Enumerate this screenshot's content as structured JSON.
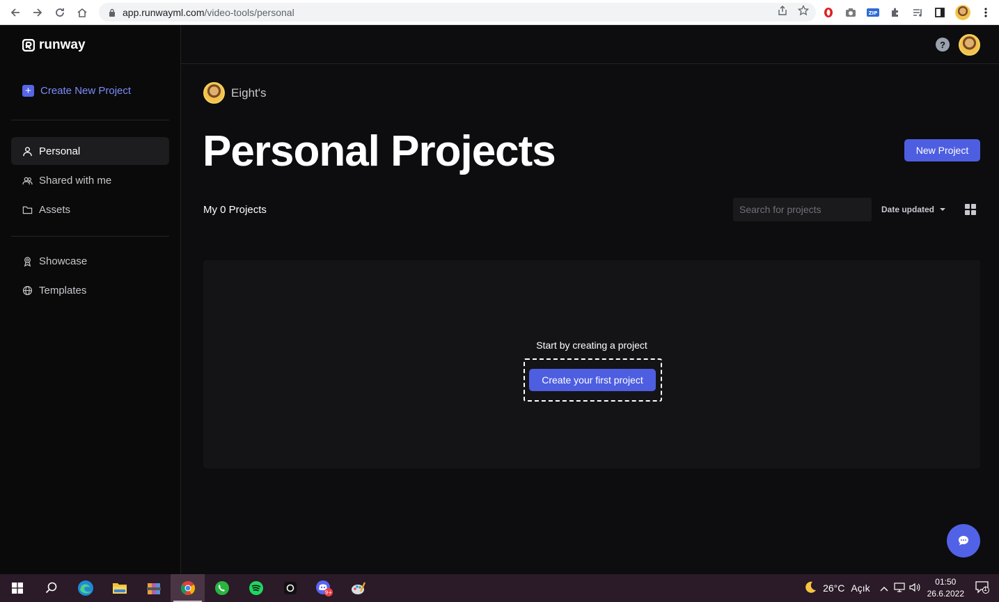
{
  "browser": {
    "url_host": "app.runwayml.com",
    "url_path": "/video-tools/personal"
  },
  "app": {
    "brand": "runway",
    "create_new_label": "Create New Project",
    "nav_primary": [
      {
        "label": "Personal",
        "icon": "user-icon",
        "active": true
      },
      {
        "label": "Shared with me",
        "icon": "users-icon",
        "active": false
      },
      {
        "label": "Assets",
        "icon": "folder-icon",
        "active": false
      }
    ],
    "nav_secondary": [
      {
        "label": "Showcase",
        "icon": "award-icon"
      },
      {
        "label": "Templates",
        "icon": "globe-icon"
      }
    ],
    "workspace_name": "Eight's",
    "page_title": "Personal Projects",
    "new_project_label": "New Project",
    "projects_count_label": "My 0 Projects",
    "search_placeholder": "Search for projects",
    "sort_label": "Date updated",
    "empty_state_text": "Start by creating a project",
    "first_project_label": "Create your first project",
    "accent_color": "#4e5ee0"
  },
  "taskbar": {
    "weather_temp": "26°C",
    "weather_text": "Açık",
    "time": "01:50",
    "date": "26.6.2022",
    "notification_count": "1",
    "discord_badge": "9+"
  }
}
